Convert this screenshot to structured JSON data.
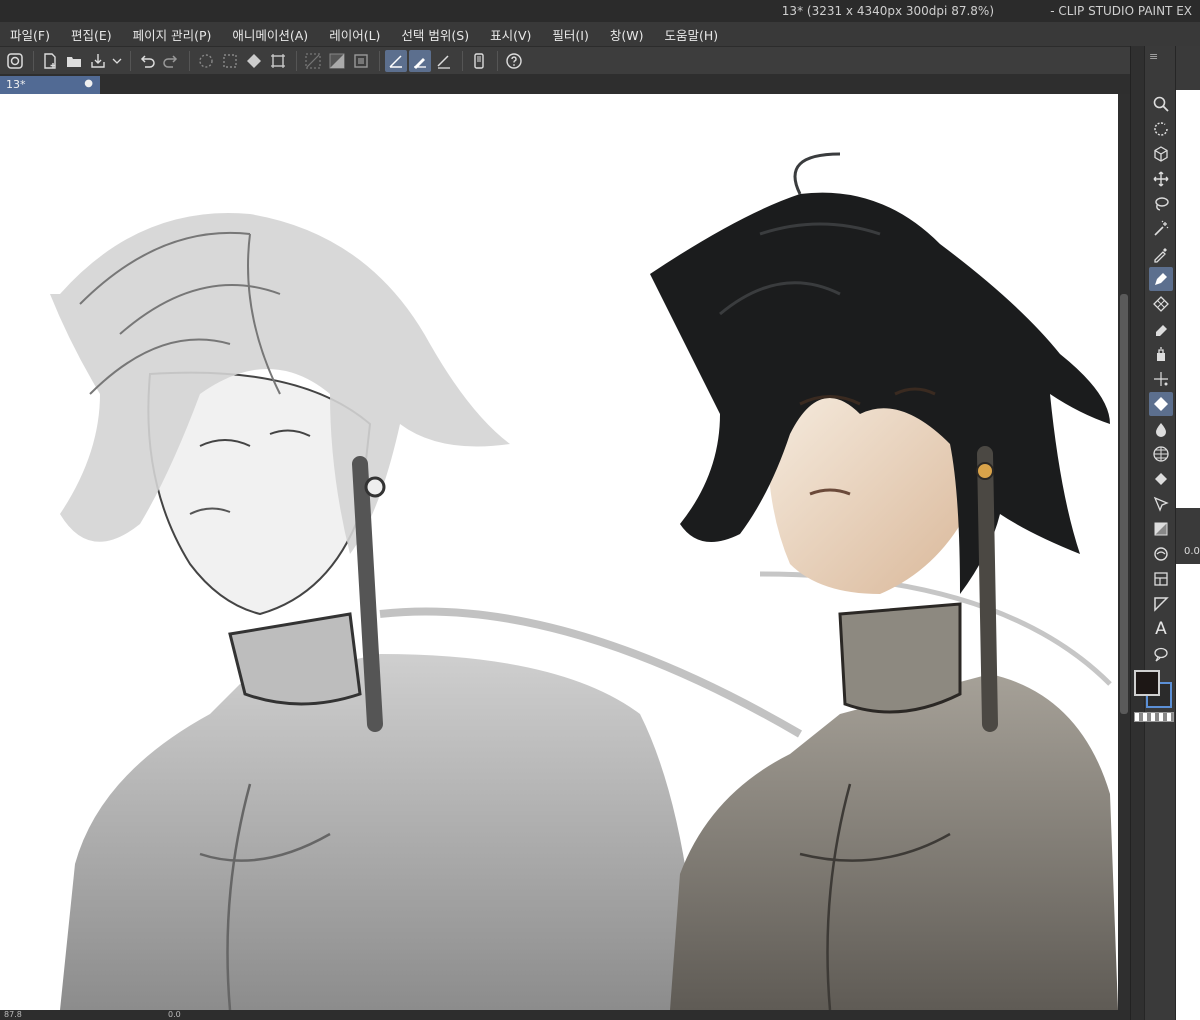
{
  "window": {
    "title": "13* (3231 x 4340px 300dpi 87.8%)",
    "app_name": "- CLIP STUDIO PAINT EX"
  },
  "menu": [
    {
      "label": "파일(F)"
    },
    {
      "label": "편집(E)"
    },
    {
      "label": "페이지 관리(P)"
    },
    {
      "label": "애니메이션(A)"
    },
    {
      "label": "레이어(L)"
    },
    {
      "label": "선택 범위(S)"
    },
    {
      "label": "표시(V)"
    },
    {
      "label": "필터(I)"
    },
    {
      "label": "창(W)"
    },
    {
      "label": "도움말(H)"
    }
  ],
  "command_bar": {
    "icons": [
      "cs-logo-icon",
      "new-file-icon",
      "open-folder-icon",
      "save-icon",
      "undo-icon",
      "redo-icon",
      "transform-icon",
      "clear-icon",
      "fill-icon",
      "crop-icon",
      "selection-icon",
      "invert-icon",
      "mask-icon",
      "ruler-snap-icon",
      "brush-snap-icon",
      "line-icon",
      "tablet-icon",
      "help-icon"
    ]
  },
  "tab": {
    "label": "13*",
    "modified_marker": "●"
  },
  "status": {
    "zoom": "87.8",
    "angle": "0.0"
  },
  "tools": [
    "zoom-icon",
    "rotate-icon",
    "3d-object-icon",
    "move-icon",
    "lasso-icon",
    "magic-wand-icon",
    "eyedropper-icon",
    "pen-icon",
    "pattern-icon",
    "eraser-icon",
    "airbrush-icon",
    "decoration-icon",
    "blend-icon",
    "watercolor-icon",
    "grid-icon",
    "fill-bucket-icon",
    "figure-icon",
    "gradient-icon",
    "frame-icon",
    "ruler-icon",
    "vector-icon",
    "text-icon",
    "balloon-icon"
  ],
  "colors": {
    "foreground": "#1d1715",
    "accent": "#5c6f8e"
  },
  "side_panel": {
    "value": "0.0"
  }
}
